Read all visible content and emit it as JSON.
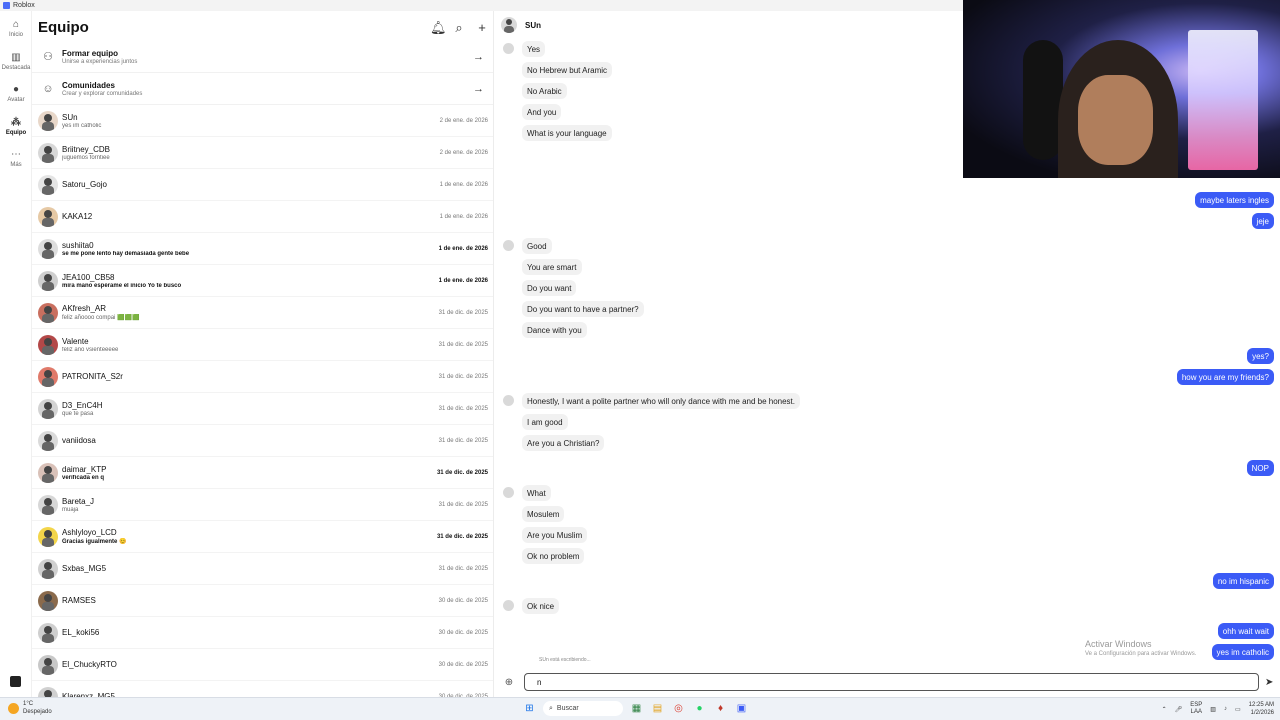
{
  "window": {
    "title": "Roblox"
  },
  "rail": [
    {
      "label": "Inicio",
      "icon": "home-icon",
      "glyph": "⌂"
    },
    {
      "label": "Destacada",
      "icon": "charts-icon",
      "glyph": "▥"
    },
    {
      "label": "Avatar",
      "icon": "avatar-icon",
      "glyph": "●"
    },
    {
      "label": "Equipo",
      "icon": "party-icon",
      "glyph": "⁂"
    },
    {
      "label": "Más",
      "icon": "more-icon",
      "glyph": "⋯"
    }
  ],
  "list": {
    "title": "Equipo",
    "actions": [
      {
        "name": "Formar equipo",
        "sub": "Unirse a experiencias juntos",
        "icon": "add-person-icon",
        "glyph": "⚇"
      },
      {
        "name": "Comunidades",
        "sub": "Crear y explorar comunidades",
        "icon": "communities-icon",
        "glyph": "☺"
      }
    ],
    "chats": [
      {
        "name": "SUn",
        "preview": "yes im catholic",
        "date": "2 de ene. de 2026",
        "unread": false,
        "color": "#e8d7c9"
      },
      {
        "name": "Briitney_CDB",
        "preview": "juguemos forntiee",
        "date": "2 de ene. de 2026",
        "unread": false,
        "color": "#d8d8d8"
      },
      {
        "name": "Satoru_Gojo",
        "preview": "",
        "date": "1 de ene. de 2026",
        "unread": false,
        "color": "#e4e4e4"
      },
      {
        "name": "KAKA12",
        "preview": "",
        "date": "1 de ene. de 2026",
        "unread": false,
        "color": "#e6c9a5"
      },
      {
        "name": "sushiita0",
        "preview": "se me pone lento hay demasiada gente bebe",
        "date": "1 de ene. de 2026",
        "unread": true,
        "color": "#dddddd"
      },
      {
        "name": "JEA100_CB58",
        "preview": "mira mano espérame el inicio Yo te busco",
        "date": "1 de ene. de 2026",
        "unread": true,
        "color": "#cfcfcf"
      },
      {
        "name": "AKfresh_AR",
        "preview": "feliz añoooo compai 🟩🟩🟩",
        "date": "31 de dic. de 2025",
        "unread": false,
        "color": "#c96f5f"
      },
      {
        "name": "Valente",
        "preview": "feliz año vsienteeeee",
        "date": "31 de dic. de 2025",
        "unread": false,
        "color": "#b34848"
      },
      {
        "name": "PATRONITA_S2r",
        "preview": "",
        "date": "31 de dic. de 2025",
        "unread": false,
        "color": "#e07a6a"
      },
      {
        "name": "D3_EnC4H",
        "preview": "que te pasa",
        "date": "31 de dic. de 2025",
        "unread": false,
        "color": "#d3d3d3"
      },
      {
        "name": "vaniidosa",
        "preview": "",
        "date": "31 de dic. de 2025",
        "unread": false,
        "color": "#dadada"
      },
      {
        "name": "daimar_KTP",
        "preview": "verificada en q",
        "date": "31 de dic. de 2025",
        "unread": true,
        "color": "#d9c1b8"
      },
      {
        "name": "Bareta_J",
        "preview": "muaja",
        "date": "31 de dic. de 2025",
        "unread": false,
        "color": "#d7d7d7"
      },
      {
        "name": "Ashlyloyo_LCD",
        "preview": "Gracias igualmente 😊",
        "date": "31 de dic. de 2025",
        "unread": true,
        "color": "#f3d54a"
      },
      {
        "name": "Sxbas_MG5",
        "preview": "",
        "date": "31 de dic. de 2025",
        "unread": false,
        "color": "#d0d0d0"
      },
      {
        "name": "RAMSES",
        "preview": "",
        "date": "30 de dic. de 2025",
        "unread": false,
        "color": "#8a6a4c"
      },
      {
        "name": "EL_koki56",
        "preview": "",
        "date": "30 de dic. de 2025",
        "unread": false,
        "color": "#cfcfcf"
      },
      {
        "name": "El_ChuckyRTO",
        "preview": "",
        "date": "30 de dic. de 2025",
        "unread": false,
        "color": "#c8c8c8"
      },
      {
        "name": "Klarenxz_MG5",
        "preview": "",
        "date": "30 de dic. de 2025",
        "unread": false,
        "color": "#d0d0d0"
      }
    ]
  },
  "conversation": {
    "name": "SUn",
    "messages": [
      {
        "dir": "in",
        "text": "Yes",
        "avatar": true
      },
      {
        "dir": "in",
        "text": "No Hebrew but Aramic"
      },
      {
        "dir": "in",
        "text": "No Arabic"
      },
      {
        "dir": "in",
        "text": "And you"
      },
      {
        "dir": "in",
        "text": "What is your language"
      },
      {
        "dir": "out",
        "text": "maybe laters ingles"
      },
      {
        "dir": "out",
        "text": "jeje"
      },
      {
        "dir": "in",
        "text": "Good",
        "avatar": true
      },
      {
        "dir": "in",
        "text": "You are smart"
      },
      {
        "dir": "in",
        "text": "Do you want"
      },
      {
        "dir": "in",
        "text": "Do you want to have a partner?"
      },
      {
        "dir": "in",
        "text": "Dance with you"
      },
      {
        "dir": "out",
        "text": "yes?"
      },
      {
        "dir": "out",
        "text": "how you are my friends?"
      },
      {
        "dir": "in",
        "text": "Honestly, I want a polite partner who will only dance with me and be honest.",
        "avatar": true
      },
      {
        "dir": "in",
        "text": "I am good"
      },
      {
        "dir": "in",
        "text": "Are you a Christian?"
      },
      {
        "dir": "out",
        "text": "NOP"
      },
      {
        "dir": "in",
        "text": "What",
        "avatar": true
      },
      {
        "dir": "in",
        "text": "Mosulem"
      },
      {
        "dir": "in",
        "text": "Are you Muslim"
      },
      {
        "dir": "in",
        "text": "Ok no problem"
      },
      {
        "dir": "out",
        "text": "no im hispanic"
      },
      {
        "dir": "in",
        "text": "Ok nice",
        "avatar": true
      },
      {
        "dir": "out",
        "text": "ohh wait wait"
      },
      {
        "dir": "out",
        "text": "yes im catholic"
      }
    ],
    "typing": "SUn está escribiendo...",
    "composer_value": "n",
    "colors": {
      "outgoing": "#3b5bf6",
      "incoming": "#f1f1f1"
    }
  },
  "watermark": {
    "line1": "Activar Windows",
    "line2": "Ve a Configuración para activar Windows."
  },
  "taskbar": {
    "temperature": "1°C",
    "weather": "Despejado",
    "search": "Buscar",
    "lang1": "ESP",
    "lang2": "LAA",
    "time": "12:25 AM",
    "date": "1/2/2026"
  }
}
